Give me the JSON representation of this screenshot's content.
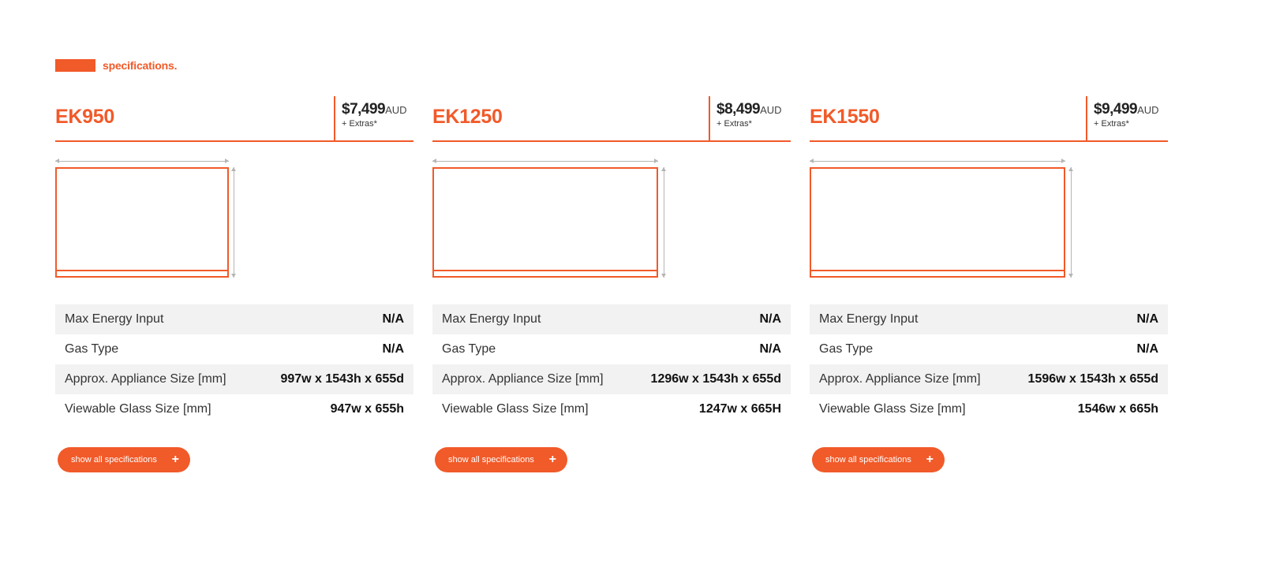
{
  "section": {
    "title": "specifications.",
    "accent_color": "#f15a29"
  },
  "products": [
    {
      "model": "EK950",
      "price": "$7,499",
      "currency": "AUD",
      "extras": "+ Extras*",
      "specs": [
        {
          "label": "Max Energy Input",
          "value": "N/A"
        },
        {
          "label": "Gas Type",
          "value": "N/A"
        },
        {
          "label": "Approx. Appliance Size [mm]",
          "value": "997w x 1543h x 655d"
        },
        {
          "label": "Viewable Glass Size [mm]",
          "value": "947w x 655h"
        }
      ],
      "button_label": "show all specifications"
    },
    {
      "model": "EK1250",
      "price": "$8,499",
      "currency": "AUD",
      "extras": "+ Extras*",
      "specs": [
        {
          "label": "Max Energy Input",
          "value": "N/A"
        },
        {
          "label": "Gas Type",
          "value": "N/A"
        },
        {
          "label": "Approx. Appliance Size [mm]",
          "value": "1296w x 1543h x 655d"
        },
        {
          "label": "Viewable Glass Size [mm]",
          "value": "1247w x 665H"
        }
      ],
      "button_label": "show all specifications"
    },
    {
      "model": "EK1550",
      "price": "$9,499",
      "currency": "AUD",
      "extras": "+ Extras*",
      "specs": [
        {
          "label": "Max Energy Input",
          "value": "N/A"
        },
        {
          "label": "Gas Type",
          "value": "N/A"
        },
        {
          "label": "Approx. Appliance Size [mm]",
          "value": "1596w x 1543h x 655d"
        },
        {
          "label": "Viewable Glass Size [mm]",
          "value": "1546w x 665h"
        }
      ],
      "button_label": "show all specifications"
    }
  ],
  "icons": {
    "expand": "plus-icon"
  }
}
